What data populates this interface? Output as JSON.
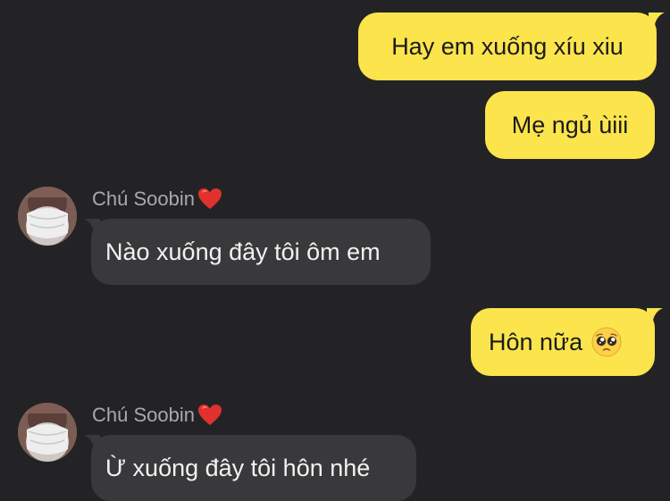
{
  "conversation": {
    "messages": [
      {
        "side": "me",
        "text": "Hay em xuống xíu xiu"
      },
      {
        "side": "me",
        "text": "Mẹ ngủ ùiii"
      },
      {
        "side": "them",
        "sender": "Chú Soobin",
        "text": "Nào xuống đây tôi ôm em"
      },
      {
        "side": "me",
        "text": "Hôn nữa",
        "emoji": "pleading-face"
      },
      {
        "side": "them",
        "sender": "Chú Soobin",
        "text": "Ừ xuống đây tôi hôn nhé"
      }
    ]
  },
  "colors": {
    "background": "#232325",
    "outgoing_bubble": "#fbe44c",
    "incoming_bubble": "#39393b",
    "sender_name": "#a9a9ad"
  }
}
